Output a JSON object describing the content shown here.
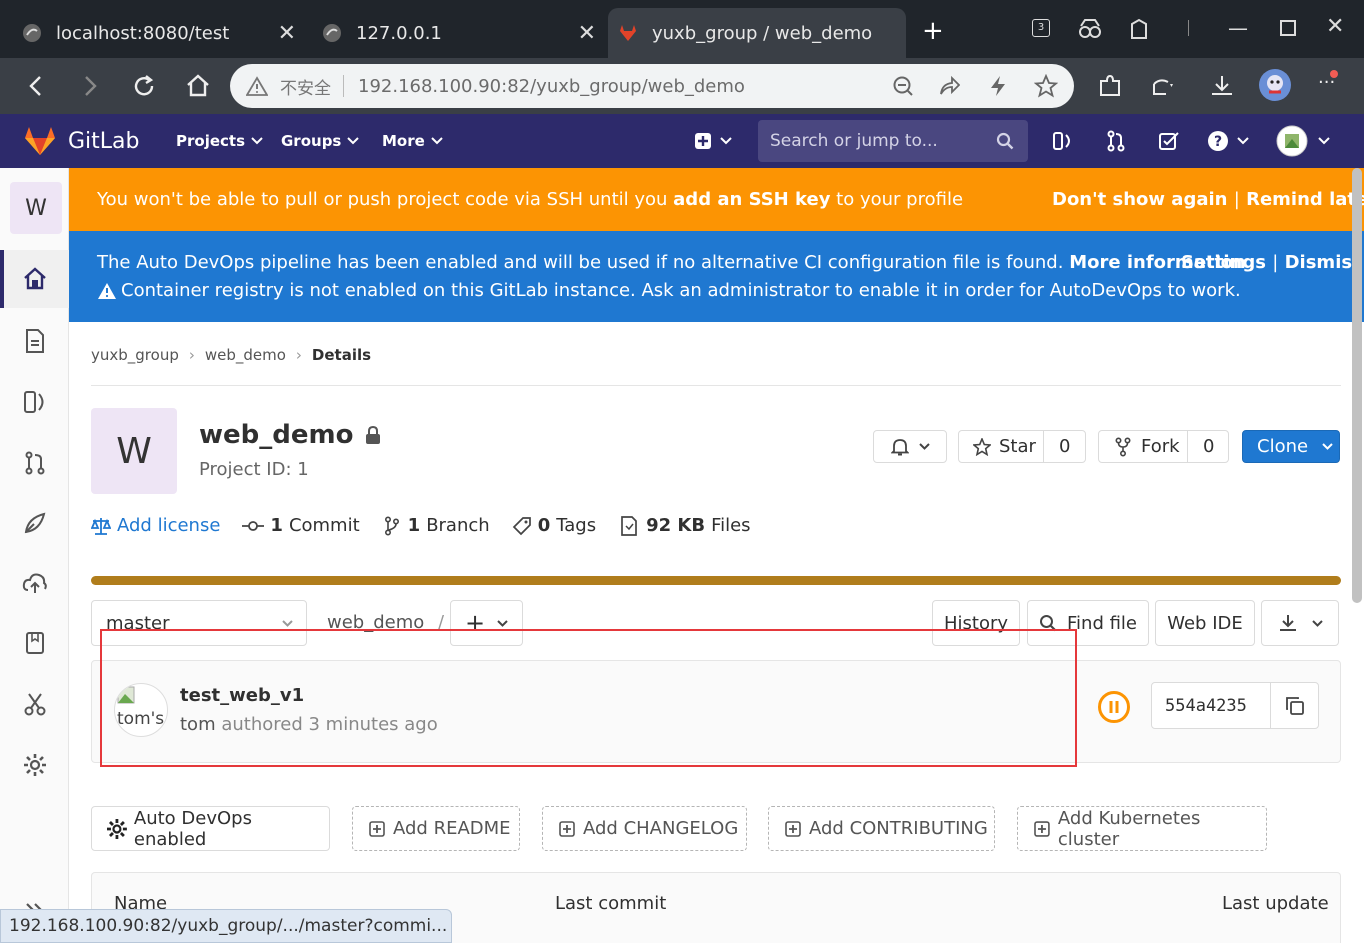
{
  "browser": {
    "tabs": [
      {
        "title": "localhost:8080/test",
        "active": false
      },
      {
        "title": "127.0.0.1",
        "active": false
      },
      {
        "title": "yuxb_group / web_demo",
        "active": true
      }
    ],
    "badge_count": "3",
    "security_label": "不安全",
    "url": "192.168.100.90:82/yuxb_group/web_demo",
    "status_url": "192.168.100.90:82/yuxb_group/.../master?commi..."
  },
  "gitlab": {
    "brand": "GitLab",
    "nav": {
      "projects": "Projects",
      "groups": "Groups",
      "more": "More"
    },
    "search_placeholder": "Search or jump to..."
  },
  "sidebar": {
    "project_letter": "W"
  },
  "ssh_banner": {
    "text_before": "You won't be able to pull or push project code via SSH until you ",
    "link": "add an SSH key",
    "text_after": " to your profile",
    "dont_show": "Don't show again",
    "separator": "|",
    "remind": "Remind later"
  },
  "devops_banner": {
    "line1": "The Auto DevOps pipeline has been enabled and will be used if no alternative CI configuration file is found.",
    "more_info": "More information",
    "line2": "Container registry is not enabled on this GitLab instance. Ask an administrator to enable it in order for AutoDevOps to work.",
    "settings": "Settings",
    "separator": "|",
    "dismiss": "Dismiss"
  },
  "breadcrumb": {
    "group": "yuxb_group",
    "project": "web_demo",
    "current": "Details"
  },
  "project": {
    "avatar_letter": "W",
    "name": "web_demo",
    "id_label": "Project ID: 1",
    "star_label": "Star",
    "star_count": "0",
    "fork_label": "Fork",
    "fork_count": "0",
    "clone_label": "Clone"
  },
  "stats": {
    "add_license": "Add license",
    "commits_num": "1",
    "commits_label": "Commit",
    "branches_num": "1",
    "branches_label": "Branch",
    "tags_num": "0",
    "tags_label": "Tags",
    "files_size": "92 KB",
    "files_label": "Files"
  },
  "repo_toolbar": {
    "branch": "master",
    "path": "web_demo",
    "path_sep": "/",
    "history": "History",
    "find_file": "Find file",
    "web_ide": "Web IDE"
  },
  "last_commit": {
    "avatar_alt": "tom's",
    "title": "test_web_v1",
    "author": "tom",
    "authored": "authored 3 minutes ago",
    "sha": "554a4235"
  },
  "actions": {
    "auto_devops": "Auto DevOps enabled",
    "add_readme": "Add README",
    "add_changelog": "Add CHANGELOG",
    "add_contributing": "Add CONTRIBUTING",
    "add_k8s": "Add Kubernetes cluster"
  },
  "table": {
    "col_name": "Name",
    "col_last_commit": "Last commit",
    "col_last_update": "Last update"
  },
  "colors": {
    "brand_nav": "#2d2a6b",
    "warning": "#fc9403",
    "info": "#1f78d1",
    "language_bar": "#b07d1c",
    "highlight": "#e5383b"
  }
}
